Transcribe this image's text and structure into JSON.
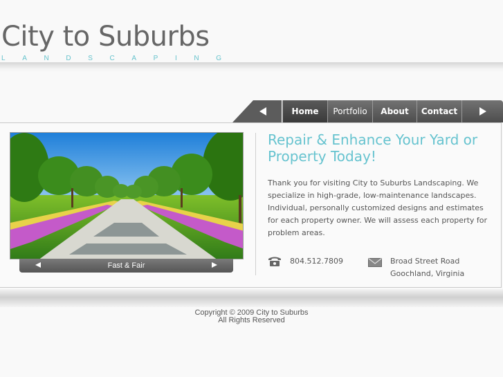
{
  "header": {
    "logo_title": "City to Suburbs",
    "logo_subtitle_letters": [
      "L",
      "A",
      "N",
      "D",
      "S",
      "C",
      "A",
      "P",
      "I",
      "N",
      "G"
    ]
  },
  "nav": {
    "prev_icon": "left-arrow-icon",
    "items": [
      {
        "label": "Home"
      },
      {
        "label": "Portfolio"
      },
      {
        "label": "About"
      },
      {
        "label": "Contact"
      }
    ],
    "next_icon": "right-arrow-icon"
  },
  "slideshow": {
    "caption": "Fast & Fair",
    "prev_icon": "triangle-left-icon",
    "next_icon": "triangle-right-icon"
  },
  "main": {
    "headline": "Repair & Enhance Your Yard or Property Today!",
    "paragraph": "Thank you for visiting City to Suburbs Landscaping. We specialize in high-grade, low-maintenance landscapes. Individual, personally customized designs and estimates for each property owner. We will assess each property for problem areas."
  },
  "contact": {
    "phone": "804.512.7809",
    "address_line1": "Broad Street Road",
    "address_line2": "Goochland, Virginia"
  },
  "footer": {
    "copyright": "Copyright © 2009 City to Suburbs",
    "rights": "All Rights Reserved"
  },
  "colors": {
    "accent": "#66c3cf",
    "nav_bg": "#5c5c5c"
  }
}
